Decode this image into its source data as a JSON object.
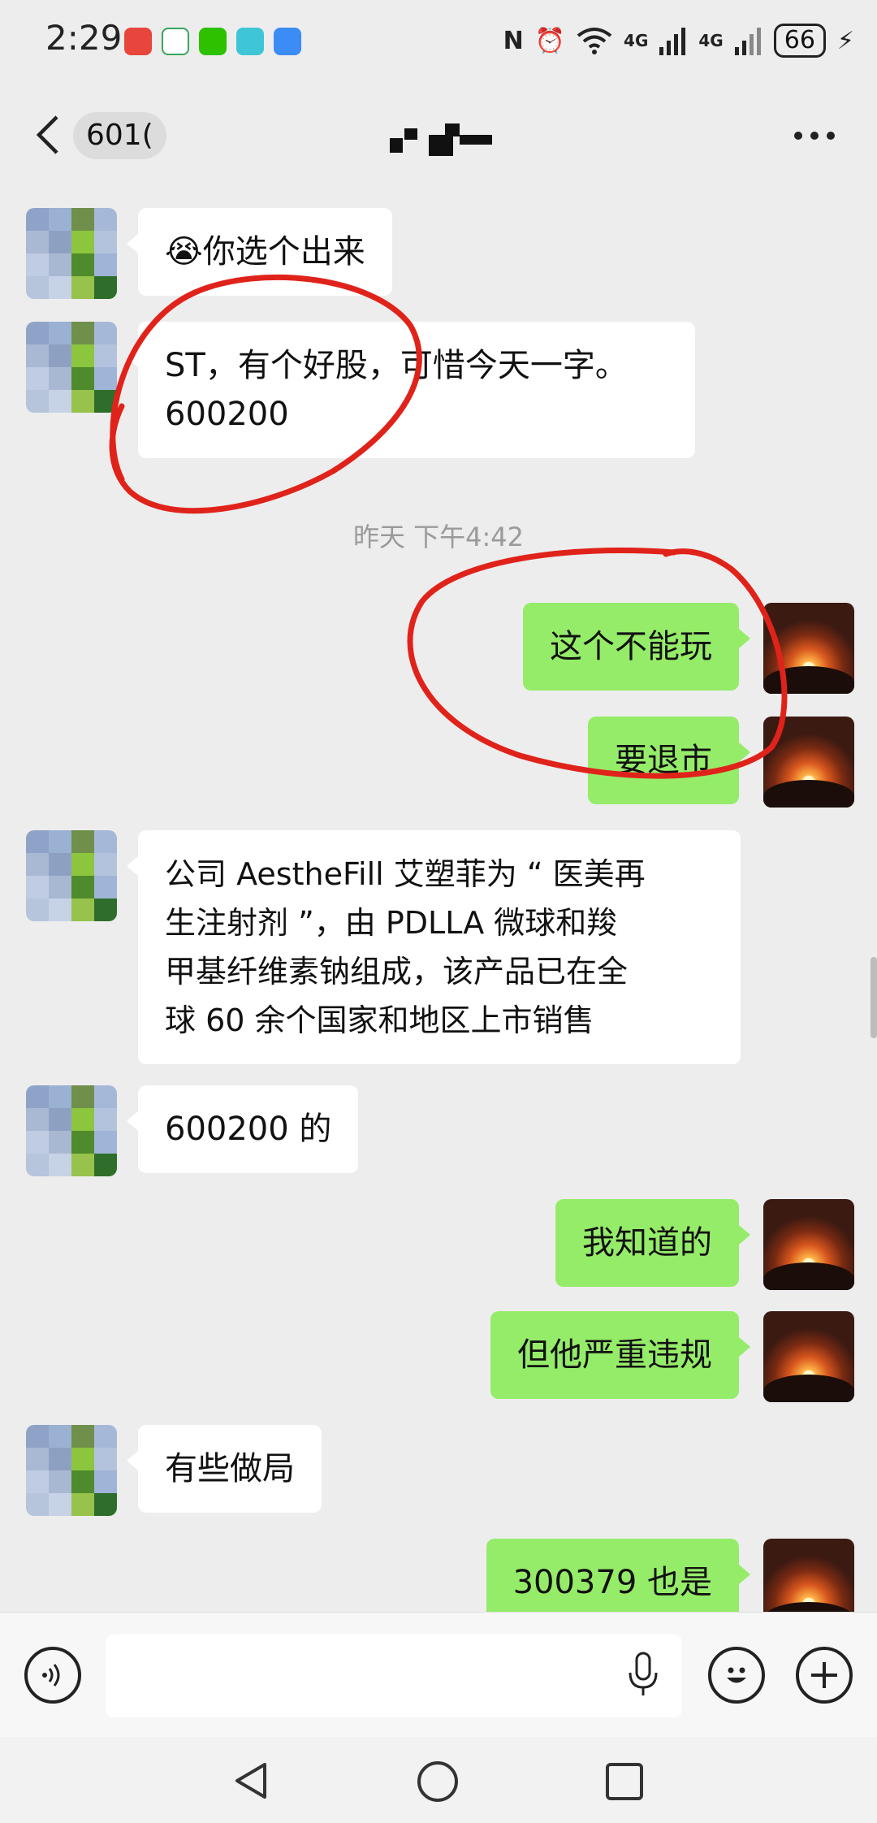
{
  "status_bar": {
    "time": "2:29",
    "network": "4G",
    "battery": "66"
  },
  "header": {
    "back_label": "601(",
    "more_icon": "more-dots-icon"
  },
  "messages": [
    {
      "side": "in",
      "text": "😭你选个出来"
    },
    {
      "side": "in",
      "text": "ST，有个好股，可惜今天一字。\n600200"
    },
    {
      "side": "out",
      "text": "这个不能玩"
    },
    {
      "side": "out",
      "text": "要退市"
    },
    {
      "side": "in",
      "text": "公司 AestheFill 艾塑菲为 “ 医美再\n生注射剂 ”，由 PDLLA 微球和羧\n甲基纤维素钠组成，该产品已在全\n球 60 余个国家和地区上市销售"
    },
    {
      "side": "in",
      "text": "600200 的"
    },
    {
      "side": "out",
      "text": "我知道的"
    },
    {
      "side": "out",
      "text": "但他严重违规"
    },
    {
      "side": "in",
      "text": "有些做局"
    },
    {
      "side": "out",
      "text": "300379 也是"
    }
  ],
  "timestamp": "昨天 下午4:42",
  "annotations": {
    "circle_color": "#e0231a"
  },
  "colors": {
    "outgoing_bubble": "#95ec69",
    "incoming_bubble": "#ffffff",
    "background": "#ededed"
  },
  "input": {
    "value": "",
    "placeholder": ""
  }
}
